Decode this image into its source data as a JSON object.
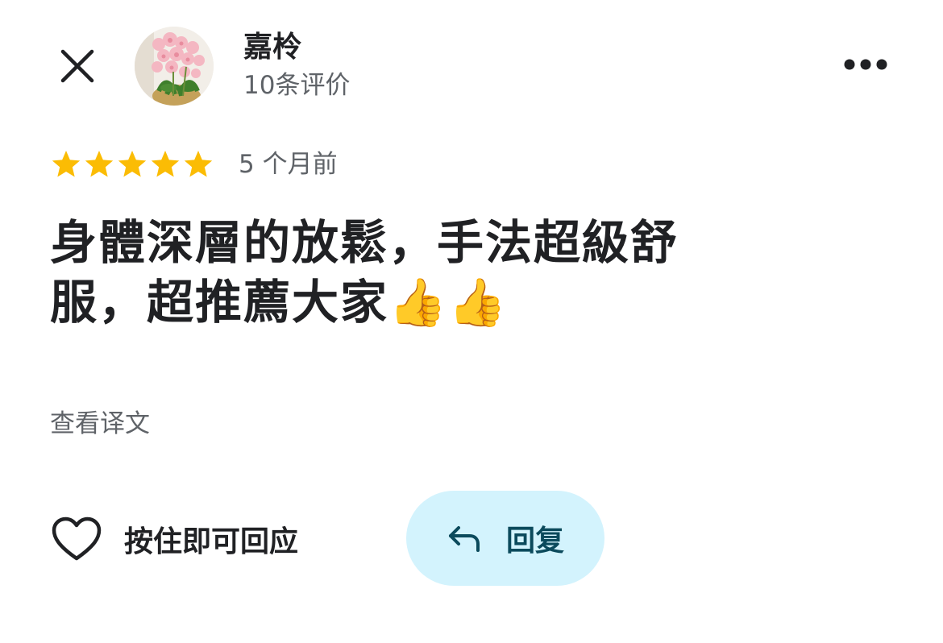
{
  "header": {
    "reviewer_name": "嘉柃",
    "review_count": "10条评价",
    "close_icon": "close-icon",
    "more_icon": "more-horizontal-icon",
    "avatar_desc": "avatar"
  },
  "rating": {
    "stars": 5,
    "max_stars": 5,
    "date": "5 个月前",
    "star_color": "#fbbc04"
  },
  "review": {
    "line1": "身體深層的放鬆，手法超級舒",
    "line2": "服，超推薦大家",
    "emoji": "👍👍"
  },
  "translate_label": "查看译文",
  "actions": {
    "like_label": "按住即可回应",
    "reply_label": "回复",
    "reply_bg": "#d3f3fd"
  }
}
